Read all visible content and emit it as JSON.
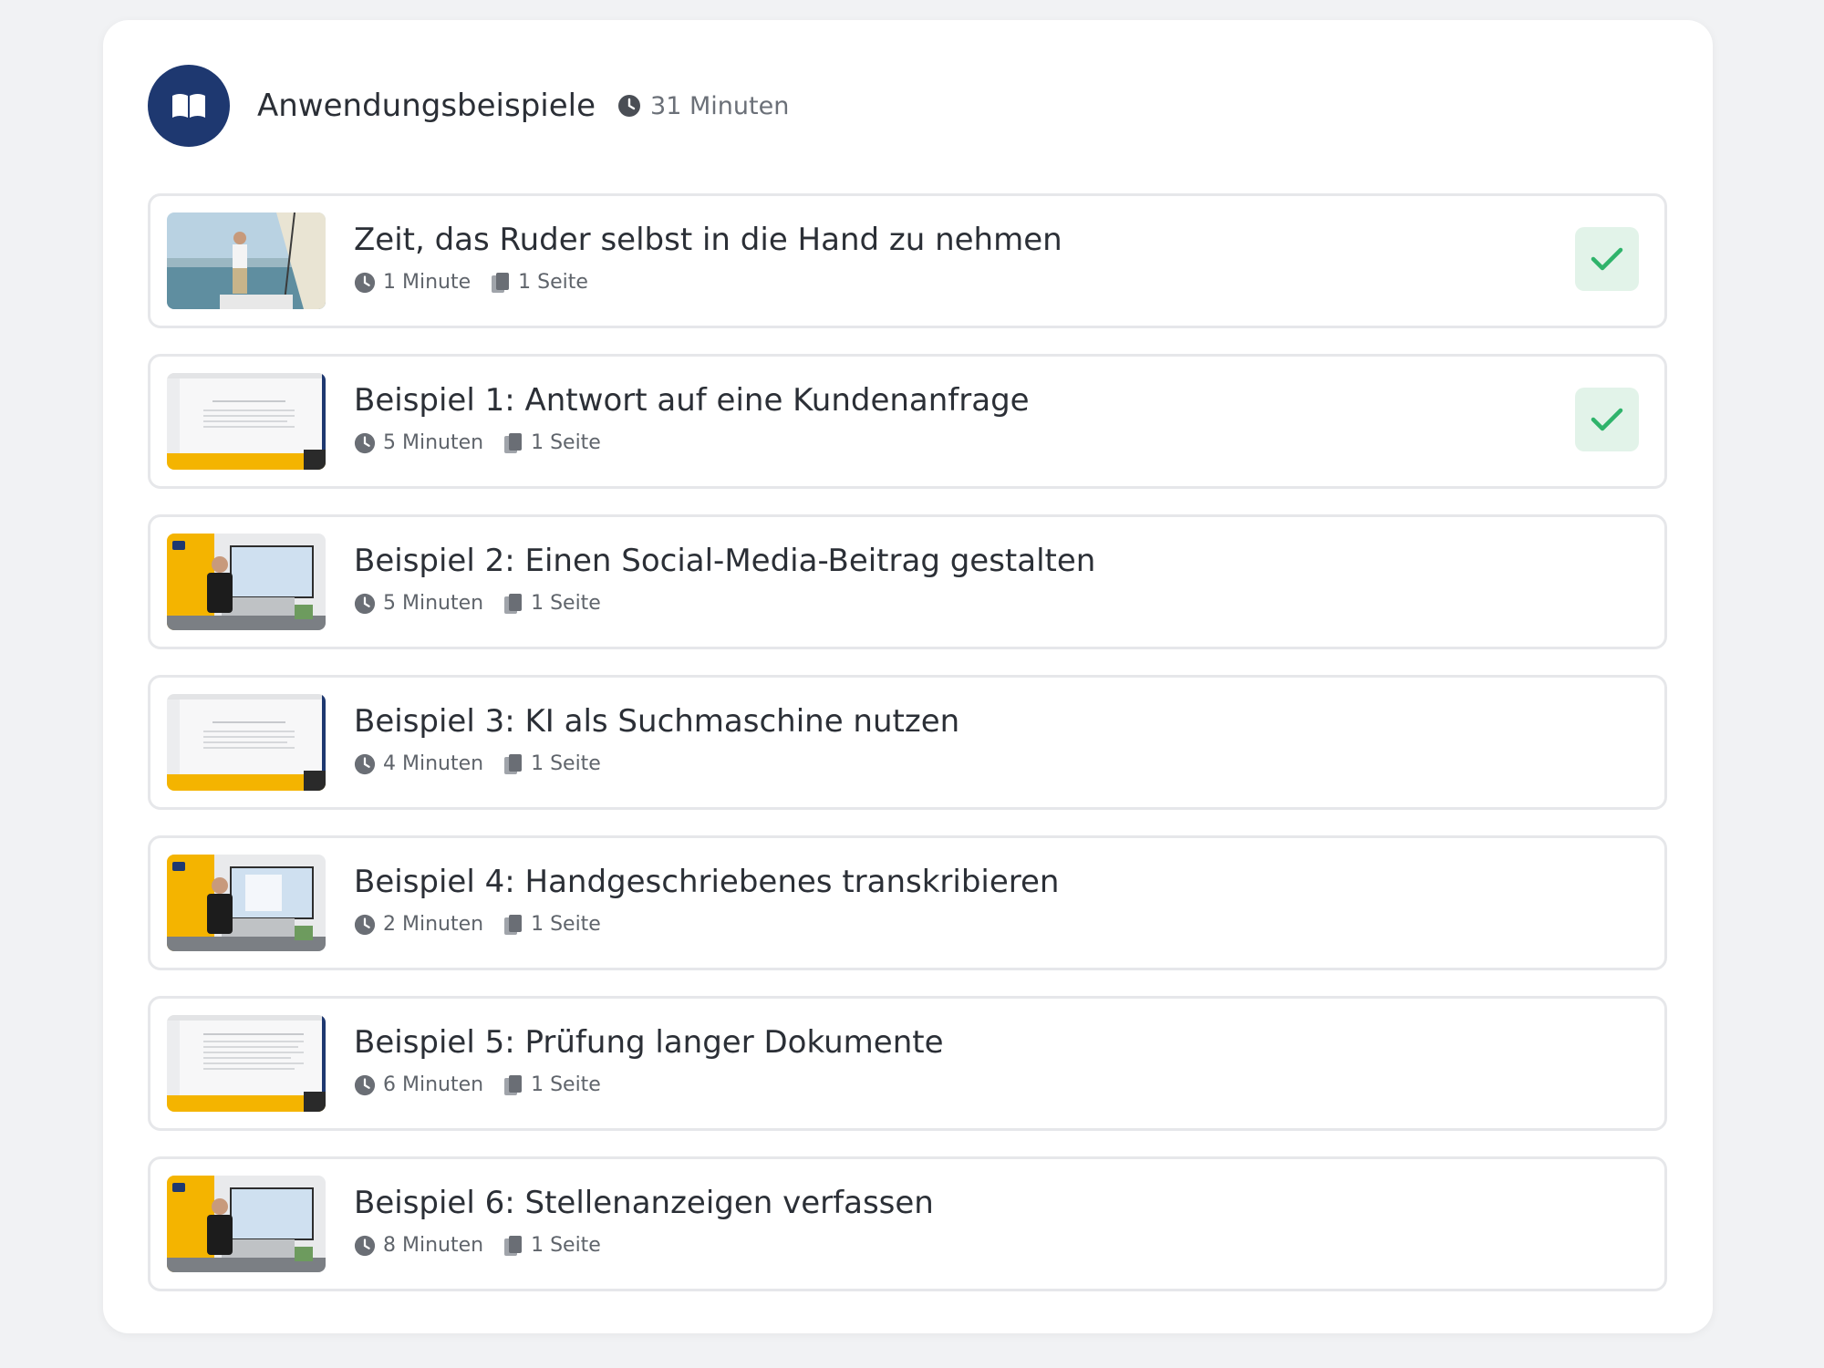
{
  "section": {
    "title": "Anwendungsbeispiele",
    "duration": "31 Minuten",
    "icon": "book-open-icon",
    "accent_color": "#1e3870"
  },
  "lessons": [
    {
      "title": "Zeit, das Ruder selbst in die Hand zu nehmen",
      "duration": "1 Minute",
      "pages": "1 Seite",
      "completed": true,
      "thumbnail": "sailboat-photo"
    },
    {
      "title": "Beispiel 1: Antwort auf eine Kundenanfrage",
      "duration": "5 Minuten",
      "pages": "1 Seite",
      "completed": true,
      "thumbnail": "screen-recording"
    },
    {
      "title": "Beispiel 2: Einen Social-Media-Beitrag gestalten",
      "duration": "5 Minuten",
      "pages": "1 Seite",
      "completed": false,
      "thumbnail": "presenter-video"
    },
    {
      "title": "Beispiel 3: KI als Suchmaschine nutzen",
      "duration": "4 Minuten",
      "pages": "1 Seite",
      "completed": false,
      "thumbnail": "screen-recording"
    },
    {
      "title": "Beispiel 4: Handgeschriebenes transkribieren",
      "duration": "2 Minuten",
      "pages": "1 Seite",
      "completed": false,
      "thumbnail": "presenter-video"
    },
    {
      "title": "Beispiel 5: Prüfung langer Dokumente",
      "duration": "6 Minuten",
      "pages": "1 Seite",
      "completed": false,
      "thumbnail": "screen-recording"
    },
    {
      "title": "Beispiel 6: Stellenanzeigen verfassen",
      "duration": "8 Minuten",
      "pages": "1 Seite",
      "completed": false,
      "thumbnail": "presenter-video"
    }
  ],
  "colors": {
    "completed_check": "#2fb36b",
    "completed_bg": "#e2f3e9",
    "thumbnail_yellow": "#f4b400"
  }
}
